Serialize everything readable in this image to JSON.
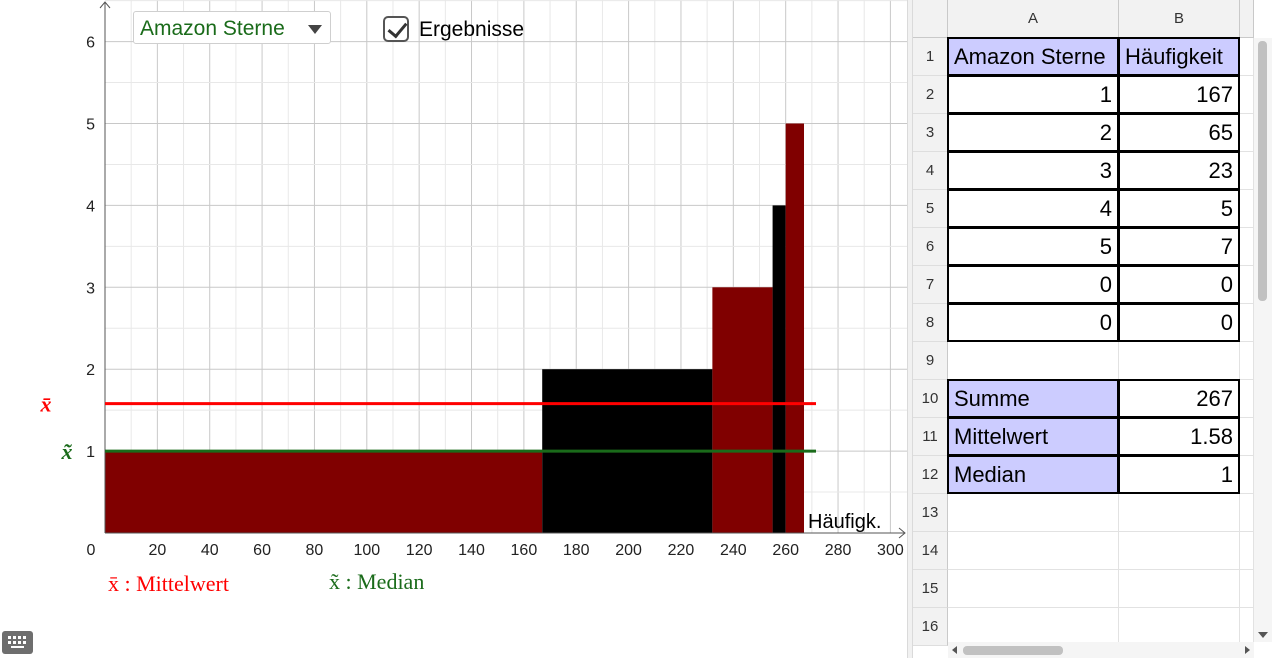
{
  "controls": {
    "dropdown_selected": "Amazon Sterne",
    "checkbox_label": "Ergebnisse",
    "checkbox_checked": true
  },
  "chart_data": {
    "type": "bar",
    "title": "",
    "xlabel": "Häufigk.",
    "ylabel": "",
    "xlim": [
      0,
      300
    ],
    "ylim": [
      0,
      6.2
    ],
    "x_ticks": [
      "0",
      "20",
      "40",
      "60",
      "80",
      "100",
      "120",
      "140",
      "160",
      "180",
      "200",
      "220",
      "240",
      "260",
      "280",
      "300"
    ],
    "y_ticks": [
      "1",
      "2",
      "3",
      "4",
      "5",
      "6"
    ],
    "grid": true,
    "bars": [
      {
        "value": 1,
        "count": 167,
        "color": "#800000"
      },
      {
        "value": 2,
        "count": 65,
        "color": "#000000"
      },
      {
        "value": 3,
        "count": 23,
        "color": "#800000"
      },
      {
        "value": 4,
        "count": 5,
        "color": "#000000"
      },
      {
        "value": 5,
        "count": 7,
        "color": "#800000"
      }
    ],
    "mean": 1.58,
    "median": 1,
    "mean_symbol": "x̄",
    "median_symbol": "x̃",
    "mean_color": "#ff0000",
    "median_color": "#1a6b1a",
    "legend": [
      {
        "text": "x̄ : Mittelwert",
        "color": "#ff0000"
      },
      {
        "text": "x̃ : Median",
        "color": "#1a6b1a"
      }
    ]
  },
  "spreadsheet": {
    "columns": [
      "A",
      "B"
    ],
    "rows": [
      "1",
      "2",
      "3",
      "4",
      "5",
      "6",
      "7",
      "8",
      "9",
      "10",
      "11",
      "12",
      "13",
      "14",
      "15",
      "16"
    ],
    "header": [
      "Amazon Sterne",
      "Häufigkeit"
    ],
    "data": [
      [
        "1",
        "167"
      ],
      [
        "2",
        "65"
      ],
      [
        "3",
        "23"
      ],
      [
        "4",
        "5"
      ],
      [
        "5",
        "7"
      ],
      [
        "0",
        "0"
      ],
      [
        "0",
        "0"
      ]
    ],
    "summary": [
      {
        "label": "Summe",
        "value": "267"
      },
      {
        "label": "Mittelwert",
        "value": "1.58"
      },
      {
        "label": "Median",
        "value": "1"
      }
    ]
  }
}
